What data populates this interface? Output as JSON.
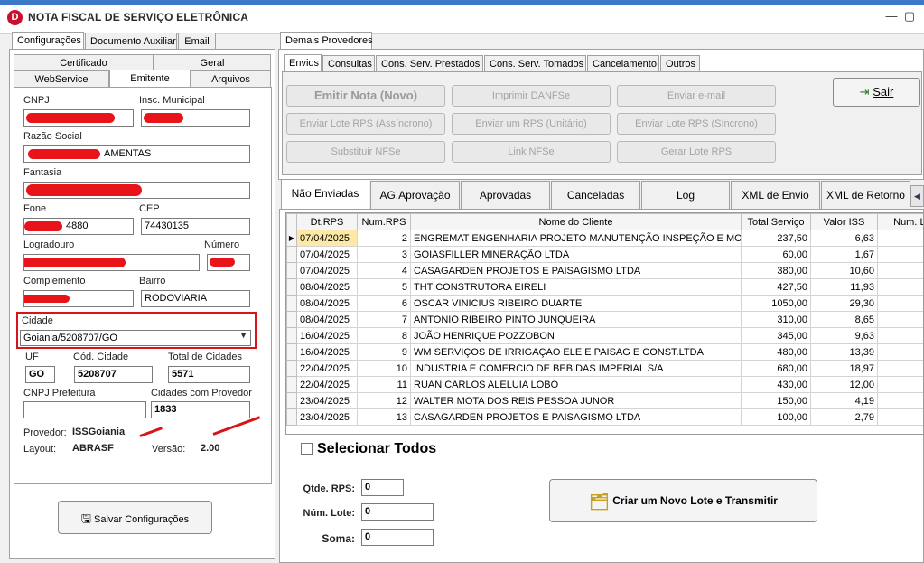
{
  "window": {
    "title": "NOTA FISCAL DE SERVIÇO ELETRÔNICA",
    "minimize": "—",
    "maximize": "▢"
  },
  "left": {
    "tabs": [
      "Configurações",
      "Documento Auxiliar",
      "Email"
    ],
    "subtabs_row1": [
      "Certificado",
      "Geral"
    ],
    "subtabs_row2": [
      "WebService",
      "Emitente",
      "Arquivos"
    ],
    "labels": {
      "cnpj": "CNPJ",
      "insc": "Insc. Municipal",
      "razao": "Razão Social",
      "fantasia": "Fantasia",
      "fone": "Fone",
      "cep": "CEP",
      "logradouro": "Logradouro",
      "numero": "Número",
      "complemento": "Complemento",
      "bairro": "Bairro",
      "cidade": "Cidade",
      "uf": "UF",
      "cod_cidade": "Cód. Cidade",
      "total_cidades": "Total de Cidades",
      "cnpj_pref": "CNPJ Prefeitura",
      "cidades_prov": "Cidades com Provedor"
    },
    "values": {
      "razao_tail": "AMENTAS",
      "fone_tail": "4880",
      "cep": "74430135",
      "bairro": "RODOVIARIA",
      "cidade": "Goiania/5208707/GO",
      "uf": "GO",
      "cod_cidade": "5208707",
      "total_cidades": "5571",
      "cnpj_pref": "",
      "cidades_prov": "1833"
    },
    "provedor_label": "Provedor:",
    "provedor": "ISSGoiania",
    "layout_label": "Layout:",
    "layout": "ABRASF",
    "versao_label": "Versão:",
    "versao": "2.00",
    "save_button": "Salvar Configurações"
  },
  "right": {
    "top_tab": "Demais Provedores",
    "tabs": [
      "Envios",
      "Consultas",
      "Cons. Serv. Prestados",
      "Cons. Serv. Tomados",
      "Cancelamento",
      "Outros"
    ],
    "buttons_row1": [
      "Emitir Nota (Novo)",
      "Imprimir DANFSe",
      "Enviar e-mail"
    ],
    "buttons_row2": [
      "Enviar Lote RPS (Assíncrono)",
      "Enviar um RPS (Unitário)",
      "Enviar Lote RPS (Síncrono)"
    ],
    "buttons_row3": [
      "Substituir NFSe",
      "Link NFSe",
      "Gerar Lote RPS"
    ],
    "sair": "Sair",
    "grid_tabs": [
      "Não Enviadas",
      "AG.Aprovação",
      "Aprovadas",
      "Canceladas",
      "Log",
      "XML de Envio",
      "XML de Retorno"
    ],
    "columns": [
      "Dt.RPS",
      "Num.RPS",
      "Nome do Cliente",
      "Total Serviço",
      "Valor ISS",
      "Num. Lote"
    ],
    "rows": [
      [
        "07/04/2025",
        "2",
        "ENGREMAT ENGENHARIA PROJETO MANUTENÇÃO INSPEÇÃO E MONTAGEN",
        "237,50",
        "6,63",
        ""
      ],
      [
        "07/04/2025",
        "3",
        "GOIASFILLER MINERAÇÃO LTDA",
        "60,00",
        "1,67",
        ""
      ],
      [
        "07/04/2025",
        "4",
        "CASAGARDEN PROJETOS E PAISAGISMO LTDA",
        "380,00",
        "10,60",
        ""
      ],
      [
        "08/04/2025",
        "5",
        "THT CONSTRUTORA EIRELI",
        "427,50",
        "11,93",
        ""
      ],
      [
        "08/04/2025",
        "6",
        "OSCAR VINICIUS RIBEIRO DUARTE",
        "1050,00",
        "29,30",
        ""
      ],
      [
        "08/04/2025",
        "7",
        "ANTONIO RIBEIRO PINTO JUNQUEIRA",
        "310,00",
        "8,65",
        ""
      ],
      [
        "16/04/2025",
        "8",
        "JOÃO HENRIQUE POZZOBON",
        "345,00",
        "9,63",
        ""
      ],
      [
        "16/04/2025",
        "9",
        "WM SERVIÇOS DE IRRIGAÇAO ELE E PAISAG E CONST.LTDA",
        "480,00",
        "13,39",
        ""
      ],
      [
        "22/04/2025",
        "10",
        "INDUSTRIA E COMERCIO DE BEBIDAS IMPERIAL S/A",
        "680,00",
        "18,97",
        ""
      ],
      [
        "22/04/2025",
        "11",
        "RUAN CARLOS ALELUIA LOBO",
        "430,00",
        "12,00",
        ""
      ],
      [
        "23/04/2025",
        "12",
        "WALTER MOTA DOS REIS PESSOA JUNOR",
        "150,00",
        "4,19",
        ""
      ],
      [
        "23/04/2025",
        "13",
        "CASAGARDEN PROJETOS E PAISAGISMO LTDA",
        "100,00",
        "2,79",
        ""
      ]
    ],
    "select_all": "Selecionar Todos",
    "qtde_label": "Qtde. RPS:",
    "qtde": "0",
    "lote_label": "Núm. Lote:",
    "lote": "0",
    "soma_label": "Soma:",
    "soma": "0",
    "create_button": "Criar um Novo Lote e Transmitir"
  },
  "colors": {
    "highlight_border": "#d8141a",
    "redaction": "#e8141a",
    "title_accent": "#c8102e"
  }
}
